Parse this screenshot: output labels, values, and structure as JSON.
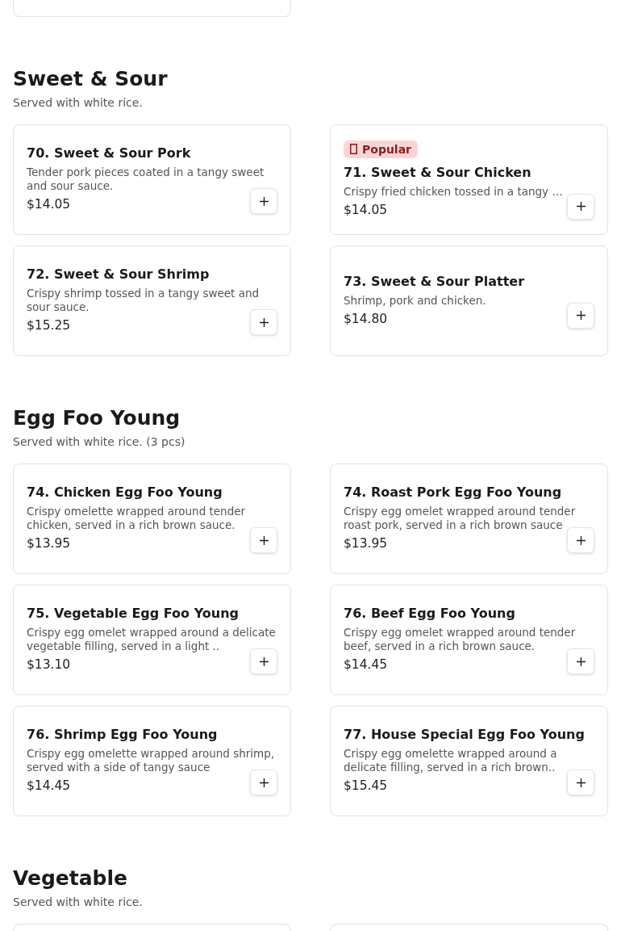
{
  "sections": [
    {
      "title": "Sweet & Sour",
      "subtitle": "Served with white rice.",
      "items": [
        {
          "name": "70. Sweet & Sour Pork",
          "description": "Tender pork pieces coated in a tangy sweet and sour sauce.",
          "price": "$14.05"
        },
        {
          "name": "71. Sweet & Sour Chicken",
          "description": "Crispy fried chicken tossed in a tangy …",
          "price": "$14.05",
          "badge": {
            "label": "Popular"
          }
        },
        {
          "name": "72. Sweet & Sour Shrimp",
          "description": "Crispy shrimp tossed in a tangy sweet and sour sauce.",
          "price": "$15.25"
        },
        {
          "name": "73. Sweet & Sour Platter",
          "description": "Shrimp, pork and chicken.",
          "price": "$14.80"
        }
      ]
    },
    {
      "title": "Egg Foo Young",
      "subtitle": "Served with white rice. (3 pcs)",
      "items": [
        {
          "name": "74. Chicken Egg Foo Young",
          "description": "Crispy omelette wrapped around tender chicken, served in a rich brown sauce.",
          "price": "$13.95"
        },
        {
          "name": "74. Roast Pork Egg Foo Young",
          "description": "Crispy egg omelet wrapped around tender roast pork, served in a rich brown sauce",
          "price": "$13.95"
        },
        {
          "name": "75. Vegetable Egg Foo Young",
          "description": "Crispy egg omelet wrapped around a delicate vegetable filling, served in a light ..",
          "price": "$13.10"
        },
        {
          "name": "76. Beef Egg Foo Young",
          "description": "Crispy egg omelet wrapped around tender beef, served in a rich brown sauce.",
          "price": "$14.45"
        },
        {
          "name": "76. Shrimp Egg Foo Young",
          "description": "Crispy egg omelette wrapped around shrimp, served with a side of tangy sauce",
          "price": "$14.45"
        },
        {
          "name": "77. House Special Egg Foo Young",
          "description": "Crispy egg omelette wrapped around a delicate filling, served in a rich brown..",
          "price": "$15.45"
        }
      ]
    },
    {
      "title": "Vegetable",
      "subtitle": "Served with white rice."
    }
  ]
}
